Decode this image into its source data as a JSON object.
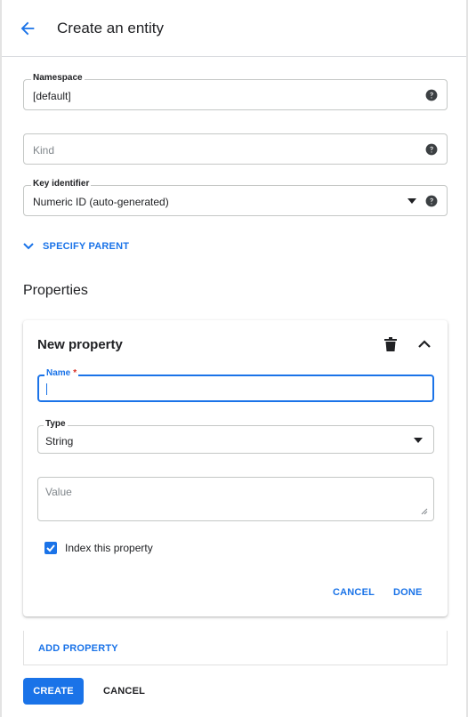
{
  "header": {
    "back_icon": "arrow-left-icon",
    "title": "Create an entity"
  },
  "form": {
    "namespace": {
      "label": "Namespace",
      "value": "[default]",
      "icon": "help-icon"
    },
    "kind": {
      "placeholder": "Kind",
      "icon": "help-icon"
    },
    "key_identifier": {
      "label": "Key identifier",
      "value": "Numeric ID (auto-generated)",
      "icon": "dropdown-caret-icon"
    },
    "specify_parent": {
      "label": "SPECIFY PARENT",
      "icon": "chevron-down-icon"
    }
  },
  "properties": {
    "title": "Properties",
    "card": {
      "title": "New property",
      "name_field": {
        "label": "Name",
        "required_mark": "*",
        "value": ""
      },
      "type_field": {
        "label": "Type",
        "value": "String"
      },
      "value_field": {
        "placeholder": "Value"
      },
      "index_checkbox": {
        "label": "Index this property",
        "checked": true
      },
      "cancel_label": "CANCEL",
      "done_label": "DONE"
    },
    "add_property_label": "ADD PROPERTY"
  },
  "footer": {
    "create_label": "CREATE",
    "cancel_label": "CANCEL"
  },
  "colors": {
    "accent": "#1a73e8",
    "required": "#d93025",
    "text": "#202124",
    "placeholder": "#80868b",
    "border": "#c4c7c5"
  }
}
